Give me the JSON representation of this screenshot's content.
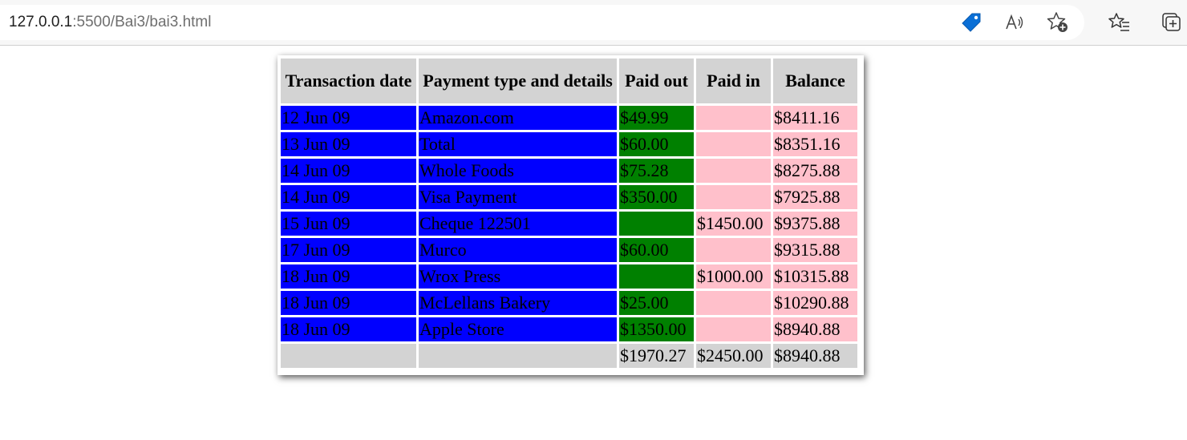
{
  "browser": {
    "url_host": "127.0.0.1",
    "url_path": ":5500/Bai3/bai3.html",
    "icons": [
      "price-tag-icon",
      "read-aloud-icon",
      "add-favorite-icon",
      "favorites-icon",
      "collections-icon"
    ]
  },
  "table": {
    "headers": {
      "date": "Transaction date",
      "desc": "Payment type and details",
      "out": "Paid out",
      "in": "Paid in",
      "bal": "Balance"
    },
    "rows": [
      {
        "date": "12 Jun 09",
        "desc": "Amazon.com",
        "out": "$49.99",
        "in": "",
        "bal": "$8411.16"
      },
      {
        "date": "13 Jun 09",
        "desc": "Total",
        "out": "$60.00",
        "in": "",
        "bal": "$8351.16"
      },
      {
        "date": "14 Jun 09",
        "desc": "Whole Foods",
        "out": "$75.28",
        "in": "",
        "bal": "$8275.88"
      },
      {
        "date": "14 Jun 09",
        "desc": "Visa Payment",
        "out": "$350.00",
        "in": "",
        "bal": "$7925.88"
      },
      {
        "date": "15 Jun 09",
        "desc": "Cheque 122501",
        "out": "",
        "in": "$1450.00",
        "bal": "$9375.88"
      },
      {
        "date": "17 Jun 09",
        "desc": "Murco",
        "out": "$60.00",
        "in": "",
        "bal": "$9315.88"
      },
      {
        "date": "18 Jun 09",
        "desc": "Wrox Press",
        "out": "",
        "in": "$1000.00",
        "bal": "$10315.88"
      },
      {
        "date": "18 Jun 09",
        "desc": "McLellans Bakery",
        "out": "$25.00",
        "in": "",
        "bal": "$10290.88"
      },
      {
        "date": "18 Jun 09",
        "desc": "Apple Store",
        "out": "$1350.00",
        "in": "",
        "bal": "$8940.88"
      }
    ],
    "totals": {
      "date": "",
      "desc": "",
      "out": "$1970.27",
      "in": "$2450.00",
      "bal": "$8940.88"
    },
    "colors": {
      "header_bg": "#d3d3d3",
      "date_desc_bg": "#0000ff",
      "paid_out_bg": "#008000",
      "paid_in_balance_bg": "#ffc0cb",
      "total_row_bg": "#d3d3d3"
    }
  }
}
